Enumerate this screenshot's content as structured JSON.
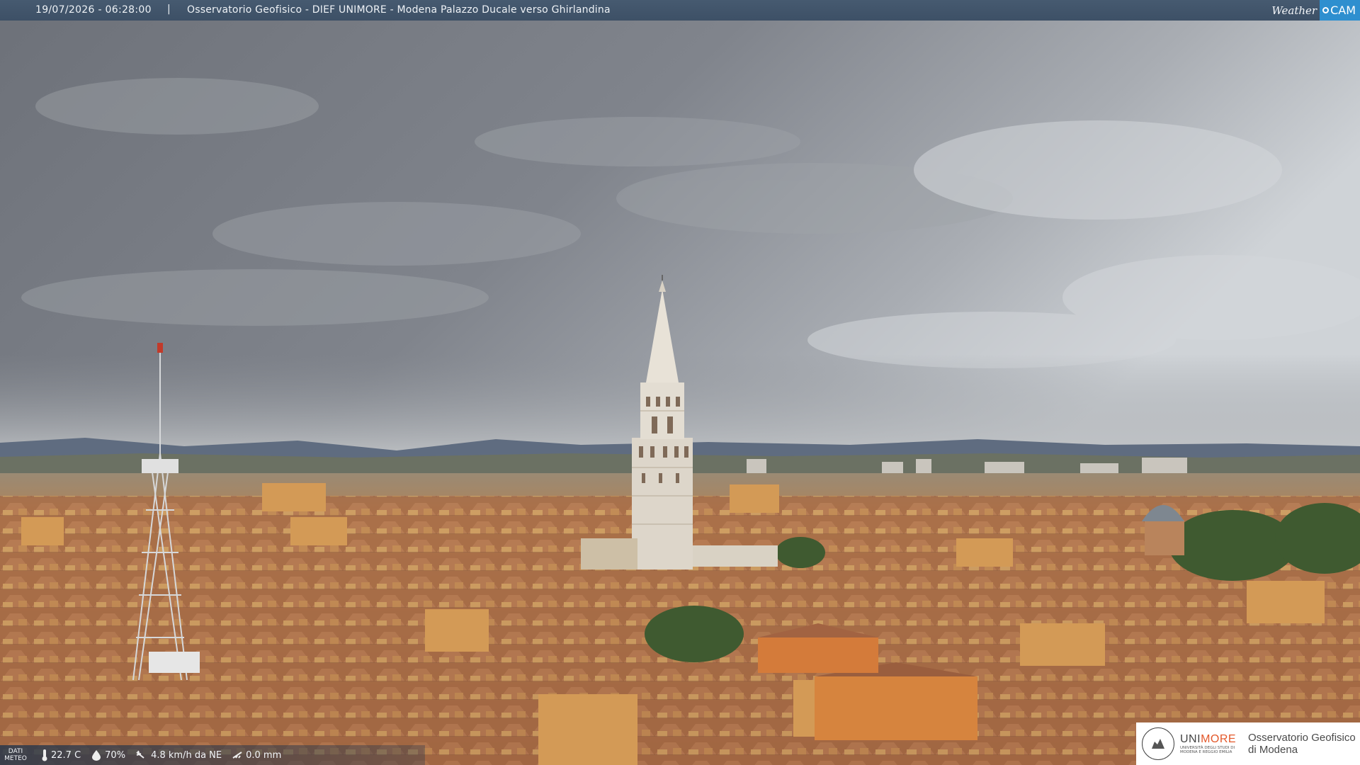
{
  "overlay": {
    "timestamp": "19/07/2026 - 06:28:00",
    "separator": "|",
    "title": "Osservatorio Geofisico - DIEF UNIMORE - Modena Palazzo Ducale verso Ghirlandina",
    "brand_weather": "Weather",
    "brand_cam": "CAM"
  },
  "meteo": {
    "label_line1": "DATI",
    "label_line2": "METEO",
    "temperature": "22.7 C",
    "humidity": "70%",
    "wind": "4.8 km/h da NE",
    "rain": "0.0 mm"
  },
  "logo": {
    "uni_prefix": "UNI",
    "uni_suffix": "MORE",
    "uni_small_1": "UNIVERSITÀ DEGLI STUDI DI",
    "uni_small_2": "MODENA E REGGIO EMILIA",
    "obs_line1": "Osservatorio Geofisico",
    "obs_line2": "di Modena"
  },
  "colors": {
    "sky_dark": "#6f737b",
    "sky_light": "#c9cdd2",
    "roof": "#b5714a",
    "wall": "#d9a25e",
    "tower": "#e3ddd2",
    "hills": "#5f6c80",
    "brand_blue": "#2e8fcf",
    "logo_orange": "#e3582a"
  }
}
